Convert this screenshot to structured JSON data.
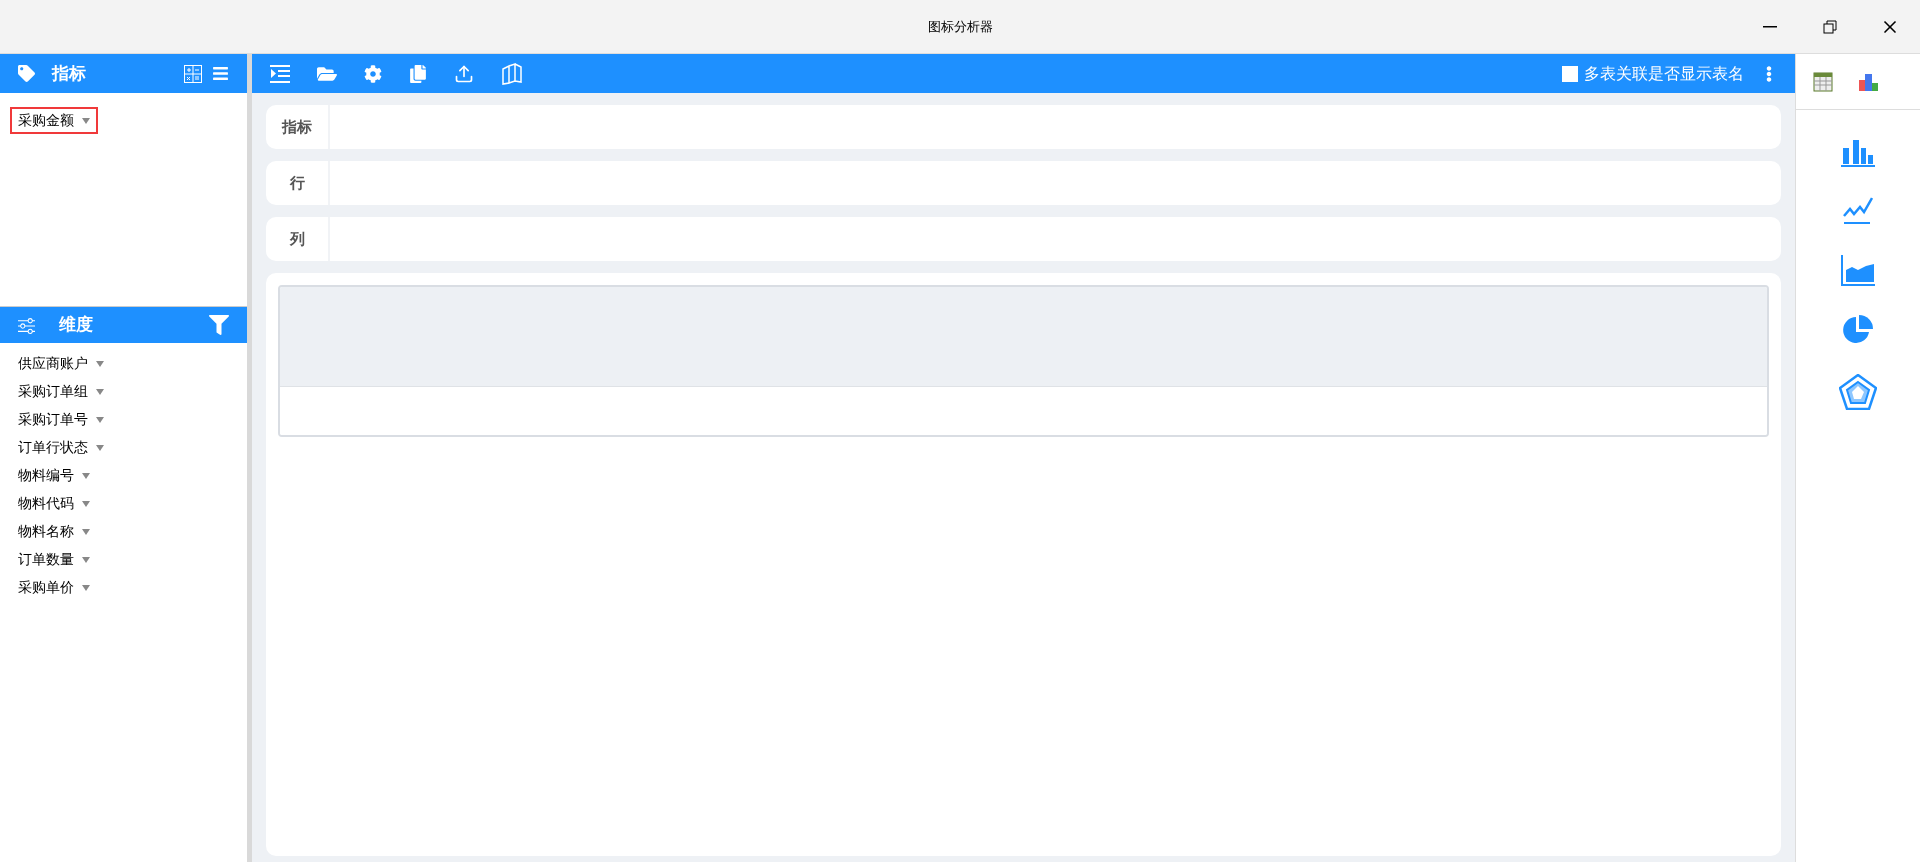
{
  "window": {
    "title": "图标分析器"
  },
  "metrics_panel": {
    "title": "指标",
    "items": [
      {
        "label": "采购金额",
        "selected": true
      }
    ]
  },
  "dimensions_panel": {
    "title": "维度",
    "items": [
      {
        "label": "供应商账户",
        "selected": false
      },
      {
        "label": "采购订单组",
        "selected": false
      },
      {
        "label": "采购订单号",
        "selected": false
      },
      {
        "label": "订单行状态",
        "selected": false
      },
      {
        "label": "物料编号",
        "selected": false
      },
      {
        "label": "物料代码",
        "selected": false
      },
      {
        "label": "物料名称",
        "selected": false
      },
      {
        "label": "订单数量",
        "selected": false
      },
      {
        "label": "采购单价",
        "selected": false
      }
    ]
  },
  "toolbar": {
    "show_table_names": {
      "label": "多表关联是否显示表名",
      "checked": false
    }
  },
  "drop_zones": [
    {
      "label": "指标"
    },
    {
      "label": "行"
    },
    {
      "label": "列"
    }
  ],
  "chart_types": [
    {
      "kind": "bar"
    },
    {
      "kind": "line"
    },
    {
      "kind": "area"
    },
    {
      "kind": "pie"
    },
    {
      "kind": "radar"
    }
  ]
}
